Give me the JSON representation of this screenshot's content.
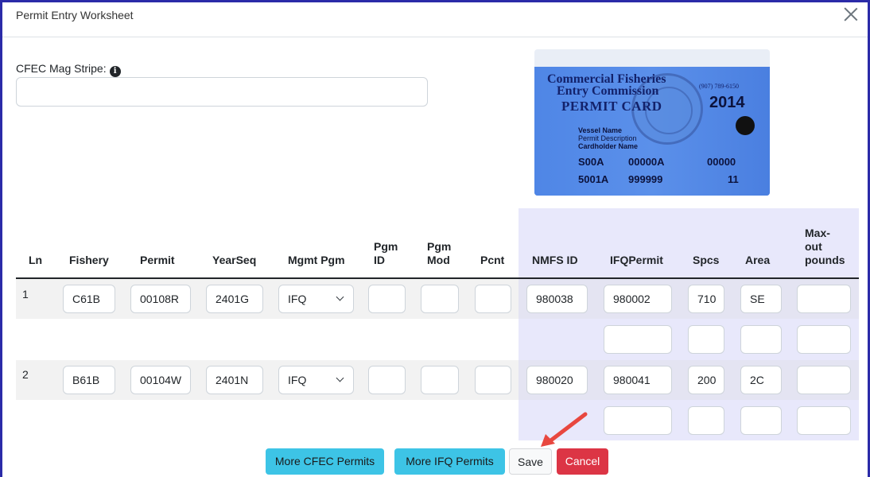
{
  "dialog": {
    "title": "Permit Entry Worksheet"
  },
  "mag_stripe": {
    "label": "CFEC Mag Stripe:",
    "value": ""
  },
  "card": {
    "line1": "Commercial Fisheries",
    "line2": "Entry Commission",
    "line3": "PERMIT CARD",
    "phone": "(907) 789-6150",
    "year": "2014",
    "vessel": "Vessel Name",
    "permit_desc": "Permit Description",
    "cardholder": "Cardholder Name",
    "r1a": "S00A",
    "r1b": "00000A",
    "r1c": "00000",
    "r2a": "5001A",
    "r2b": "999999",
    "r2c": "11"
  },
  "table": {
    "headers": {
      "ln": "Ln",
      "fishery": "Fishery",
      "permit": "Permit",
      "yearseq": "YearSeq",
      "mgmt": "Mgmt Pgm",
      "pgm_id_1": "Pgm",
      "pgm_id_2": "ID",
      "pgm_mod_1": "Pgm",
      "pgm_mod_2": "Mod",
      "pcnt": "Pcnt",
      "nmfs": "NMFS ID",
      "ifq": "IFQPermit",
      "spcs": "Spcs",
      "area": "Area",
      "max_1": "Max-",
      "max_2": "out",
      "max_3": "pounds"
    },
    "rows": [
      {
        "ln": "1",
        "fishery": "C61B",
        "permit": "00108R",
        "yearseq": "2401G",
        "mgmt": "IFQ",
        "pgm_id": "",
        "pgm_mod": "",
        "pcnt": "",
        "nmfs": "980038",
        "ifq": "980002",
        "spcs": "710",
        "area": "SE",
        "max": "",
        "sub": {
          "ifq": "",
          "spcs": "",
          "area": "",
          "max": ""
        }
      },
      {
        "ln": "2",
        "fishery": "B61B",
        "permit": "00104W",
        "yearseq": "2401N",
        "mgmt": "IFQ",
        "pgm_id": "",
        "pgm_mod": "",
        "pcnt": "",
        "nmfs": "980020",
        "ifq": "980041",
        "spcs": "200",
        "area": "2C",
        "max": "",
        "sub": {
          "ifq": "",
          "spcs": "",
          "area": "",
          "max": ""
        }
      }
    ]
  },
  "footer": {
    "more_cfec": "More CFEC Permits",
    "more_ifq": "More IFQ Permits",
    "save": "Save",
    "cancel": "Cancel"
  },
  "colors": {
    "accent_info": "#3dc4e6",
    "danger": "#dc3545",
    "frame": "#2b2ba8",
    "annotation_arrow": "#e8473f"
  },
  "icons": {
    "close": "close-icon",
    "info": "info-icon",
    "select": "chevron-down-icon",
    "annotation": "arrow-annotation-icon"
  }
}
